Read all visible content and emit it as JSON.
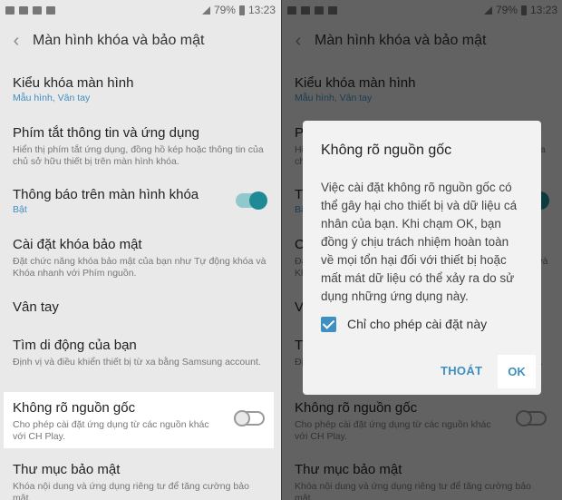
{
  "status": {
    "percent": "79%",
    "time": "13:23"
  },
  "header": {
    "back_icon": "‹",
    "title": "Màn hình khóa và bảo mật"
  },
  "items": [
    {
      "main": "Kiểu khóa màn hình",
      "sub": "Mẫu hình, Vân tay"
    },
    {
      "main": "Phím tắt thông tin và ứng dụng",
      "sub": "Hiển thị phím tắt ứng dụng, đồng hồ kép hoặc thông tin của chủ sở hữu thiết bị trên màn hình khóa."
    },
    {
      "main": "Thông báo trên màn hình khóa",
      "sub": "Bật",
      "toggle": true
    },
    {
      "main": "Cài đặt khóa bảo mật",
      "sub": "Đặt chức năng khóa bảo mật của bạn như Tự động khóa và Khóa nhanh với Phím nguồn."
    },
    {
      "main": "Vân tay",
      "sub": ""
    },
    {
      "main": "Tìm di động của bạn",
      "sub": "Định vị và điều khiển thiết bị từ xa bằng Samsung account."
    },
    {
      "main": "Không rõ nguồn gốc",
      "sub": "Cho phép cài đặt ứng dụng từ các nguồn khác với CH Play.",
      "toggle": false
    },
    {
      "main": "Thư mục bảo mật",
      "sub": "Khóa nội dung và ứng dụng riêng tư để tăng cường bảo mật."
    }
  ],
  "dialog": {
    "title": "Không rõ nguồn gốc",
    "body": "Việc cài đặt không rõ nguồn gốc có thể gây hại cho thiết bị và dữ liệu cá nhân của bạn. Khi chạm OK, bạn đồng ý chịu trách nhiệm hoàn toàn về mọi tổn hại đối với thiết bị hoặc mất mát dữ liệu có thể xảy ra do sử dụng những ứng dụng này.",
    "checkbox_label": "Chỉ cho phép cài đặt này",
    "cancel": "THOÁT",
    "ok": "OK"
  }
}
